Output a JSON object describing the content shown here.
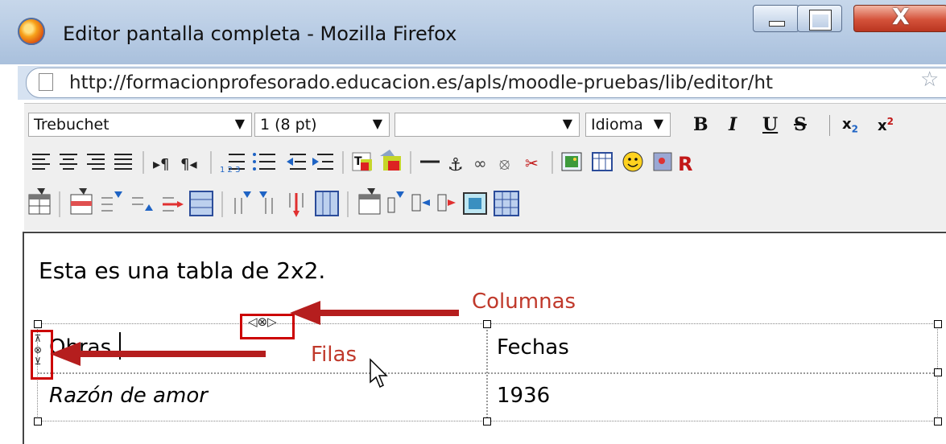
{
  "window": {
    "title": "Editor pantalla completa - Mozilla Firefox",
    "url": "http://formacionprofesorado.educacion.es/apls/moodle-pruebas/lib/editor/ht",
    "controls": {
      "close": "X"
    }
  },
  "toolbar": {
    "font_family": "Trebuchet",
    "font_size": "1 (8 pt)",
    "format": "",
    "language": "Idioma",
    "bold": "B",
    "italic": "I",
    "underline": "U",
    "strike": "S",
    "subscript": "x",
    "subscript_mark": "2",
    "superscript": "x",
    "superscript_mark": "2",
    "dropdown_arrow": "▼"
  },
  "content": {
    "paragraph": "Esta es una tabla de 2x2.",
    "table": {
      "rows": [
        [
          "Obras",
          "Fechas"
        ],
        [
          "Razón de amor",
          "1936"
        ]
      ]
    }
  },
  "annotations": {
    "columns_label": "Columnas",
    "rows_label": "Filas"
  },
  "colors": {
    "annotation": "#c0392b",
    "titlebar": "#b7cbe4",
    "close_button": "#d4523a"
  }
}
